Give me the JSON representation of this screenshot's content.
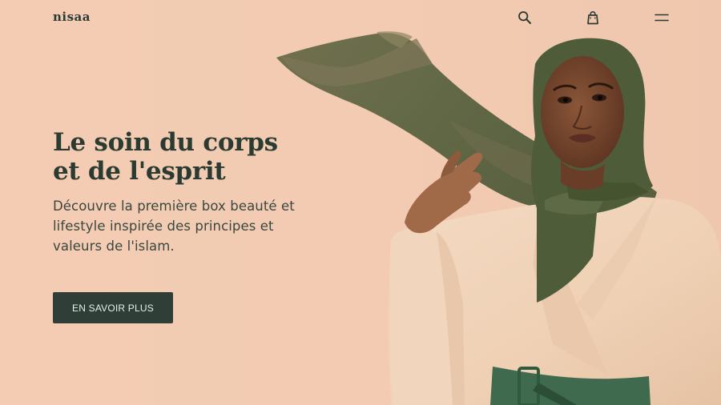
{
  "brand": {
    "logo_text": "nisaa"
  },
  "nav": {
    "search_icon": "search-icon",
    "cart_icon": "shopping-bag-icon",
    "menu_icon": "menu-icon"
  },
  "hero": {
    "title_line1": "Le soin du corps",
    "title_line2": "et de l'esprit",
    "subtitle_line1": "Découvre la première box beauté et",
    "subtitle_line2": "lifestyle inspirée des principes et",
    "subtitle_line3": "valeurs de l'islam.",
    "cta_label": "EN SAVOIR PLUS"
  },
  "colors": {
    "background": "#f2cbb2",
    "primary_dark_green": "#2f3e37",
    "scarf_olive": "#5b6443",
    "coat_beige": "#f0d2b8"
  }
}
